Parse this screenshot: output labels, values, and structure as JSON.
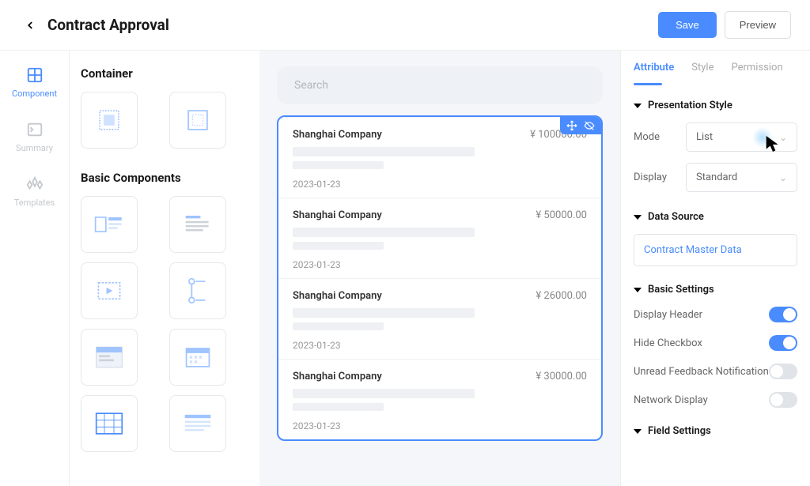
{
  "header": {
    "title": "Contract Approval",
    "save_label": "Save",
    "preview_label": "Preview"
  },
  "rail": {
    "component": "Component",
    "summary": "Summary",
    "templates": "Templates"
  },
  "components": {
    "container_title": "Container",
    "basic_title": "Basic Components"
  },
  "canvas": {
    "search_placeholder": "Search",
    "items": [
      {
        "name": "Shanghai Company",
        "amount": "¥ 100000.00",
        "date": "2023-01-23"
      },
      {
        "name": "Shanghai Company",
        "amount": "¥ 50000.00",
        "date": "2023-01-23"
      },
      {
        "name": "Shanghai Company",
        "amount": "¥ 26000.00",
        "date": "2023-01-23"
      },
      {
        "name": "Shanghai Company",
        "amount": "¥ 30000.00",
        "date": "2023-01-23"
      }
    ]
  },
  "props": {
    "tabs": {
      "attribute": "Attribute",
      "style": "Style",
      "permission": "Permission"
    },
    "presentation": {
      "title": "Presentation Style",
      "mode_label": "Mode",
      "mode_value": "List",
      "display_label": "Display",
      "display_value": "Standard"
    },
    "datasource": {
      "title": "Data Source",
      "link": "Contract Master Data"
    },
    "basic": {
      "title": "Basic Settings",
      "display_header": "Display Header",
      "hide_checkbox": "Hide Checkbox",
      "unread_feedback": "Unread Feedback Notification",
      "network_display": "Network Display"
    },
    "field": {
      "title": "Field Settings"
    }
  }
}
